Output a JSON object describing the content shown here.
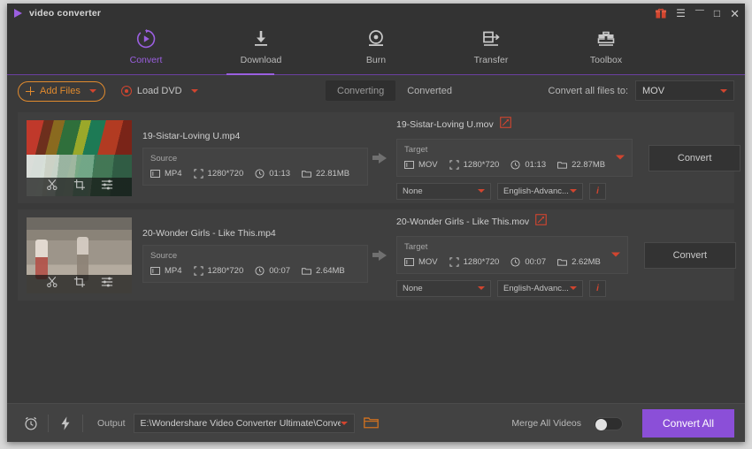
{
  "window": {
    "title": "video converter",
    "controls": [
      {
        "name": "gift-icon",
        "glyph": "♜"
      },
      {
        "name": "menu-icon",
        "glyph": "☰"
      },
      {
        "name": "minimize-icon",
        "glyph": "＿"
      },
      {
        "name": "maximize-icon",
        "glyph": "□"
      },
      {
        "name": "close-icon",
        "glyph": "✕"
      }
    ]
  },
  "nav": {
    "items": [
      {
        "label": "Convert",
        "icon": "convert-icon",
        "active": true
      },
      {
        "label": "Download",
        "icon": "download-icon",
        "active": false
      },
      {
        "label": "Burn",
        "icon": "burn-icon",
        "active": false
      },
      {
        "label": "Transfer",
        "icon": "transfer-icon",
        "active": false
      },
      {
        "label": "Toolbox",
        "icon": "toolbox-icon",
        "active": false
      }
    ]
  },
  "toolbar": {
    "add_files_label": "Add Files",
    "load_dvd_label": "Load DVD",
    "tabs": [
      {
        "label": "Converting",
        "active": true
      },
      {
        "label": "Converted",
        "active": false
      }
    ],
    "convert_all_to_label": "Convert all files to:",
    "output_format": "MOV"
  },
  "files": [
    {
      "thumb_class": "thumb-a",
      "source_name": "19-Sistar-Loving U.mp4",
      "source_title": "Source",
      "source": {
        "format": "MP4",
        "resolution": "1280*720",
        "duration": "01:13",
        "size": "22.81MB"
      },
      "target_name": "19-Sistar-Loving U.mov",
      "target_title": "Target",
      "target": {
        "format": "MOV",
        "resolution": "1280*720",
        "duration": "01:13",
        "size": "22.87MB"
      },
      "subtitle_select": "None",
      "audio_select": "English-Advanc...",
      "info_label": "i",
      "convert_label": "Convert"
    },
    {
      "thumb_class": "thumb-b",
      "source_name": "20-Wonder Girls - Like This.mp4",
      "source_title": "Source",
      "source": {
        "format": "MP4",
        "resolution": "1280*720",
        "duration": "00:07",
        "size": "2.64MB"
      },
      "target_name": "20-Wonder Girls - Like This.mov",
      "target_title": "Target",
      "target": {
        "format": "MOV",
        "resolution": "1280*720",
        "duration": "00:07",
        "size": "2.62MB"
      },
      "subtitle_select": "None",
      "audio_select": "English-Advanc...",
      "info_label": "i",
      "convert_label": "Convert"
    }
  ],
  "thumb_tools": [
    {
      "name": "trim-icon"
    },
    {
      "name": "crop-icon"
    },
    {
      "name": "effect-icon"
    }
  ],
  "bottom": {
    "output_label": "Output",
    "output_path": "E:\\Wondershare Video Converter Ultimate\\Converted",
    "merge_label": "Merge All Videos",
    "merge_on": false,
    "convert_all_label": "Convert All"
  },
  "colors": {
    "accent_purple": "#8b4fd8",
    "accent_orange": "#e08a2e",
    "accent_red": "#d1452f",
    "window_bg": "#3a3a3a"
  }
}
